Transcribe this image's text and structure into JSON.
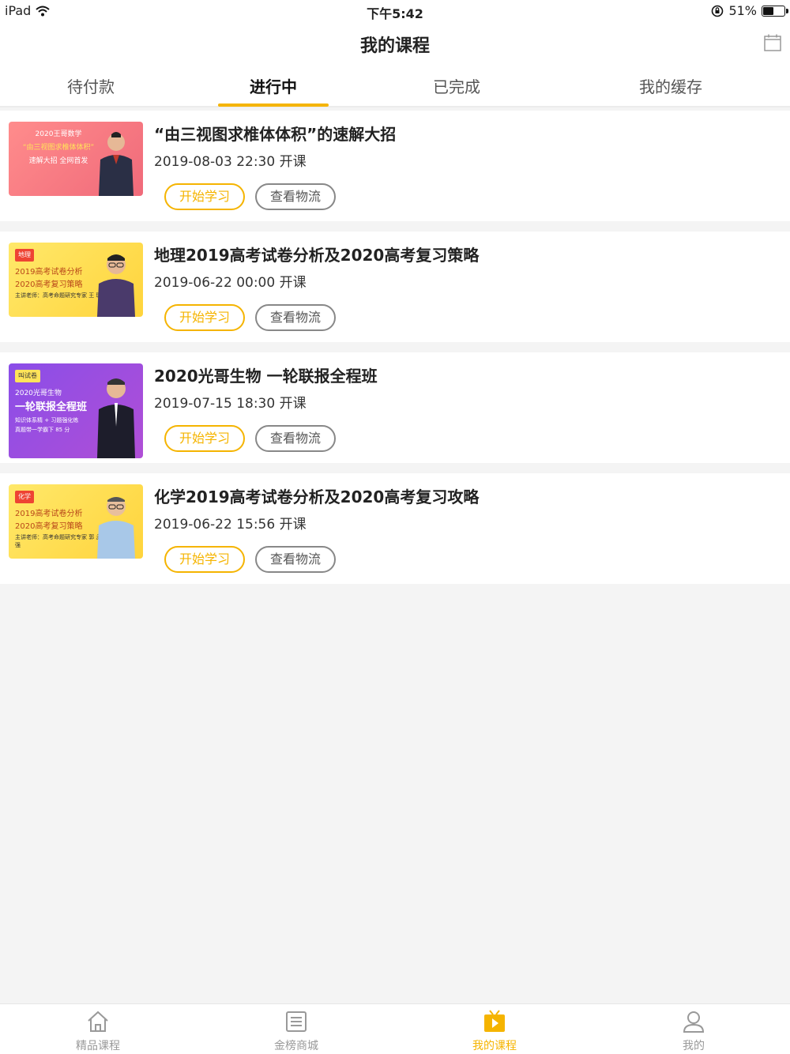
{
  "status_bar": {
    "device": "iPad",
    "time": "下午5:42",
    "battery": "51%",
    "battery_level": 0.51
  },
  "nav": {
    "title": "我的课程"
  },
  "tabs": [
    {
      "label": "待付款"
    },
    {
      "label": "进行中"
    },
    {
      "label": "已完成"
    },
    {
      "label": "我的缓存"
    }
  ],
  "courses": [
    {
      "title": "“由三视图求椎体体积”的速解大招",
      "time": "2019-08-03 22:30 开课",
      "start_label": "开始学习",
      "logistics_label": "查看物流",
      "thumb_badge": "",
      "thumb_lines": [
        "2020王哥数学",
        "“由三视图求椎体体积”",
        "速解大招 全网首发"
      ]
    },
    {
      "title": "地理2019高考试卷分析及2020高考复习策略",
      "time": "2019-06-22 00:00 开课",
      "start_label": "开始学习",
      "logistics_label": "查看物流",
      "thumb_badge": "地理",
      "thumb_lines": [
        "2019高考试卷分析",
        "2020高考复习策略",
        "主讲老师：高考命题研究专家 王 璐"
      ]
    },
    {
      "title": "2020光哥生物 一轮联报全程班",
      "time": "2019-07-15 18:30 开课",
      "start_label": "开始学习",
      "logistics_label": "查看物流",
      "thumb_badge": "叫试卷",
      "thumb_lines": [
        "2020光哥生物",
        "一轮联报全程班",
        "知识体系精 + 习题强化练",
        "真题带一学霸下 85 分"
      ]
    },
    {
      "title": "化学2019高考试卷分析及2020高考复习攻略",
      "time": "2019-06-22 15:56 开课",
      "start_label": "开始学习",
      "logistics_label": "查看物流",
      "thumb_badge": "化学",
      "thumb_lines": [
        "2019高考试卷分析",
        "2020高考复习策略",
        "主讲老师：高考命题研究专家 郭 孟 强"
      ]
    }
  ],
  "bottom_tabs": [
    {
      "label": "精品课程",
      "icon": "home-icon"
    },
    {
      "label": "金榜商城",
      "icon": "list-icon"
    },
    {
      "label": "我的课程",
      "icon": "play-tv-icon"
    },
    {
      "label": "我的",
      "icon": "person-icon"
    }
  ],
  "colors": {
    "accent": "#f5b400",
    "background": "#f4f4f4",
    "card": "#ffffff"
  }
}
